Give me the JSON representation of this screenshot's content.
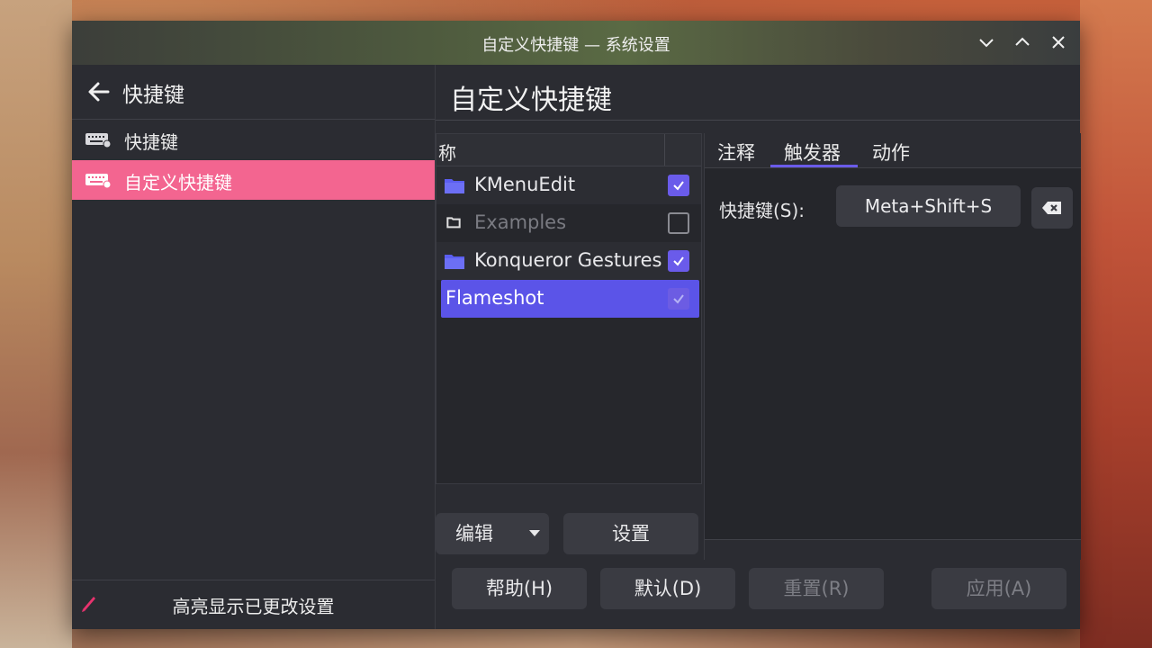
{
  "window": {
    "title": "自定义快捷键 — 系统设置"
  },
  "sidebar": {
    "heading": "快捷键",
    "items": [
      {
        "label": "快捷键",
        "active": false
      },
      {
        "label": "自定义快捷键",
        "active": true
      }
    ],
    "footer_label": "高亮显示已更改设置"
  },
  "main": {
    "title": "自定义快捷键",
    "tree": {
      "column_header": "称",
      "rows": [
        {
          "label": "KMenuEdit",
          "checked": true
        },
        {
          "label": "Examples",
          "checked": false
        },
        {
          "label": "Konqueror Gestures",
          "checked": true
        },
        {
          "label": "Flameshot",
          "checked": true,
          "selected": true
        }
      ]
    },
    "edit_button": "编辑",
    "settings_button": "设置",
    "tabs": [
      "注释",
      "触发器",
      "动作"
    ],
    "active_tab": "触发器",
    "shortcut_label": "快捷键(S):",
    "shortcut_value": "Meta+Shift+S"
  },
  "footer_buttons": {
    "help": "帮助(H)",
    "defaults": "默认(D)",
    "reset": "重置(R)",
    "apply": "应用(A)"
  },
  "colors": {
    "accent": "#6a5bea",
    "selection": "#5b54e8",
    "sidebar_active": "#f36590"
  }
}
